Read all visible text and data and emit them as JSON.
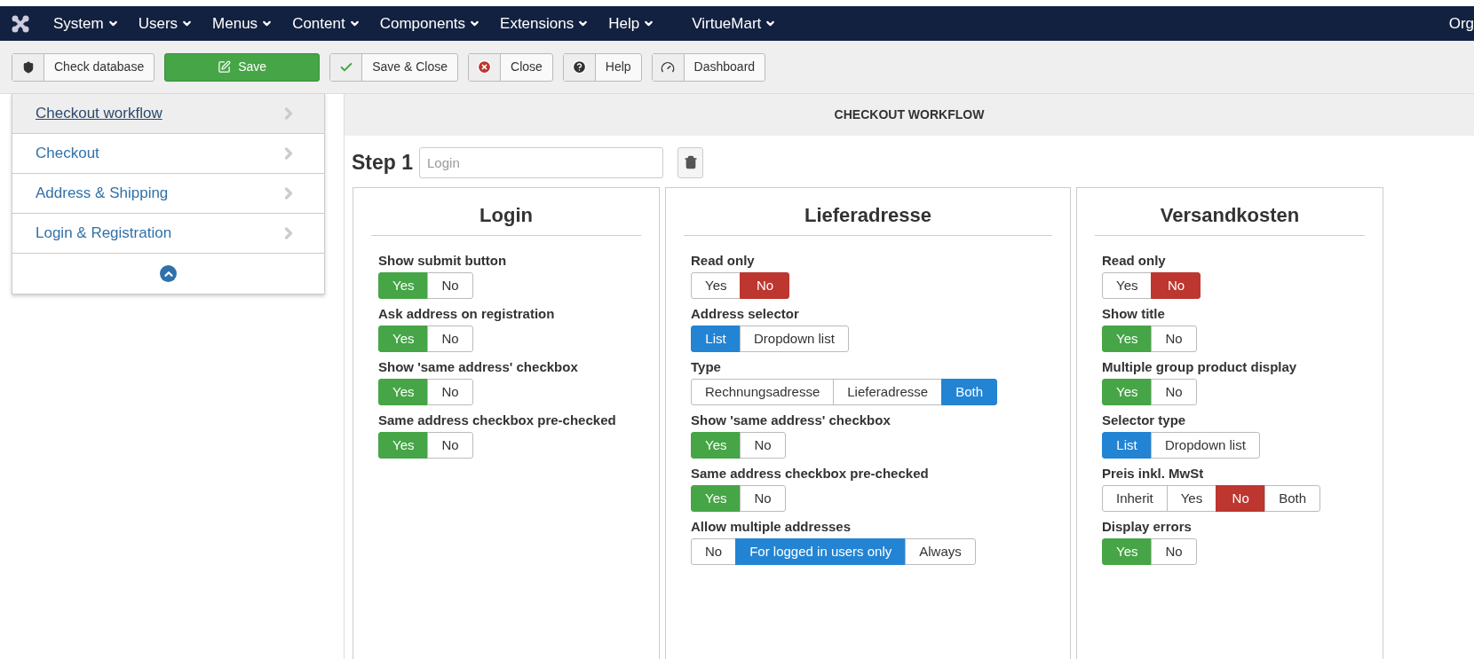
{
  "navbar": {
    "menus": [
      {
        "label": "System",
        "dropdown": true
      },
      {
        "label": "Users",
        "dropdown": true
      },
      {
        "label": "Menus",
        "dropdown": true
      },
      {
        "label": "Content",
        "dropdown": true
      },
      {
        "label": "Components",
        "dropdown": true
      },
      {
        "label": "Extensions",
        "dropdown": true
      },
      {
        "label": "Help",
        "dropdown": true
      },
      {
        "label": "VirtueMart",
        "dropdown": true
      }
    ],
    "right_text": "Org"
  },
  "toolbar": [
    {
      "label": "Check database",
      "kind": "shield"
    },
    {
      "label": "Save",
      "kind": "primary"
    },
    {
      "label": "Save & Close",
      "kind": "check"
    },
    {
      "label": "Close",
      "kind": "close"
    },
    {
      "label": "Help",
      "kind": "help"
    },
    {
      "label": "Dashboard",
      "kind": "dashboard"
    }
  ],
  "sidebar": {
    "items": [
      {
        "label": "Checkout workflow",
        "selected": true
      },
      {
        "label": "Checkout",
        "selected": false
      },
      {
        "label": "Address & Shipping",
        "selected": false
      },
      {
        "label": "Login & Registration",
        "selected": false
      }
    ]
  },
  "header": "CHECKOUT WORKFLOW",
  "step": {
    "label": "Step 1",
    "placeholder": "Login"
  },
  "panels": [
    {
      "title": "Login",
      "fields": [
        {
          "label": "Show submit button",
          "options": [
            {
              "label": "Yes",
              "selected": true,
              "color": "#46a546"
            },
            {
              "label": "No",
              "selected": false
            }
          ]
        },
        {
          "label": "Ask address on registration",
          "options": [
            {
              "label": "Yes",
              "selected": true,
              "color": "#46a546"
            },
            {
              "label": "No",
              "selected": false
            }
          ]
        },
        {
          "label": "Show 'same address' checkbox",
          "options": [
            {
              "label": "Yes",
              "selected": true,
              "color": "#46a546"
            },
            {
              "label": "No",
              "selected": false
            }
          ]
        },
        {
          "label": "Same address checkbox pre-checked",
          "options": [
            {
              "label": "Yes",
              "selected": true,
              "color": "#46a546"
            },
            {
              "label": "No",
              "selected": false
            }
          ]
        }
      ]
    },
    {
      "title": "Lieferadresse",
      "fields": [
        {
          "label": "Read only",
          "options": [
            {
              "label": "Yes",
              "selected": false
            },
            {
              "label": "No",
              "selected": true,
              "color": "#bd362f"
            }
          ]
        },
        {
          "label": "Address selector",
          "options": [
            {
              "label": "List",
              "selected": true,
              "color": "#2384d3"
            },
            {
              "label": "Dropdown list",
              "selected": false
            }
          ]
        },
        {
          "label": "Type",
          "options": [
            {
              "label": "Rechnungsadresse",
              "selected": false
            },
            {
              "label": "Lieferadresse",
              "selected": false
            },
            {
              "label": "Both",
              "selected": true,
              "color": "#2384d3"
            }
          ]
        },
        {
          "label": "Show 'same address' checkbox",
          "options": [
            {
              "label": "Yes",
              "selected": true,
              "color": "#46a546"
            },
            {
              "label": "No",
              "selected": false
            }
          ]
        },
        {
          "label": "Same address checkbox pre-checked",
          "options": [
            {
              "label": "Yes",
              "selected": true,
              "color": "#46a546"
            },
            {
              "label": "No",
              "selected": false
            }
          ]
        },
        {
          "label": "Allow multiple addresses",
          "options": [
            {
              "label": "No",
              "selected": false
            },
            {
              "label": "For logged in users only",
              "selected": true,
              "color": "#2384d3"
            },
            {
              "label": "Always",
              "selected": false
            }
          ]
        }
      ]
    },
    {
      "title": "Versandkosten",
      "fields": [
        {
          "label": "Read only",
          "options": [
            {
              "label": "Yes",
              "selected": false
            },
            {
              "label": "No",
              "selected": true,
              "color": "#bd362f"
            }
          ]
        },
        {
          "label": "Show title",
          "options": [
            {
              "label": "Yes",
              "selected": true,
              "color": "#46a546"
            },
            {
              "label": "No",
              "selected": false
            }
          ]
        },
        {
          "label": "Multiple group product display",
          "options": [
            {
              "label": "Yes",
              "selected": true,
              "color": "#46a546"
            },
            {
              "label": "No",
              "selected": false
            }
          ]
        },
        {
          "label": "Selector type",
          "options": [
            {
              "label": "List",
              "selected": true,
              "color": "#2384d3"
            },
            {
              "label": "Dropdown list",
              "selected": false
            }
          ]
        },
        {
          "label": "Preis inkl. MwSt",
          "options": [
            {
              "label": "Inherit",
              "selected": false
            },
            {
              "label": "Yes",
              "selected": false
            },
            {
              "label": "No",
              "selected": true,
              "color": "#bd362f"
            },
            {
              "label": "Both",
              "selected": false
            }
          ]
        },
        {
          "label": "Display errors",
          "options": [
            {
              "label": "Yes",
              "selected": true,
              "color": "#46a546"
            },
            {
              "label": "No",
              "selected": false
            }
          ]
        }
      ]
    }
  ]
}
